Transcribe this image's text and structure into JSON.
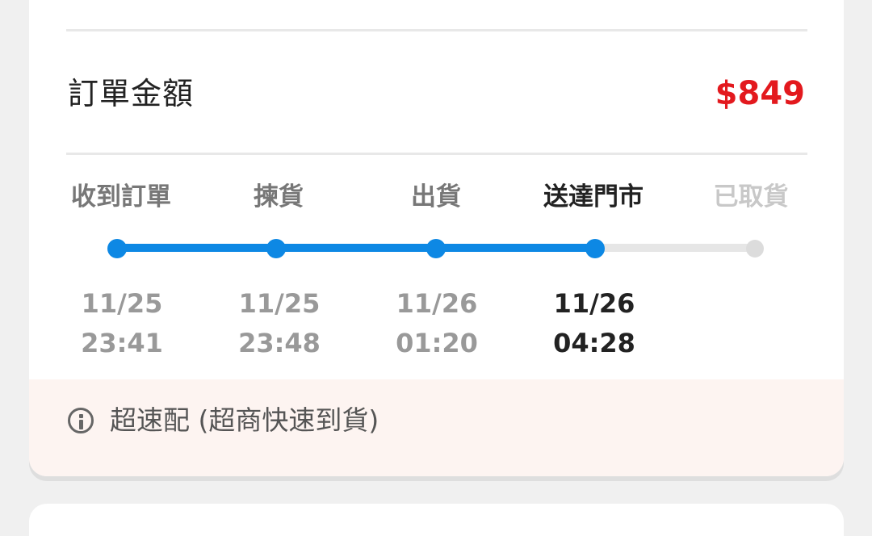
{
  "order": {
    "total_label": "訂單金額",
    "total_amount": "$849"
  },
  "tracking": {
    "progress_color": "#0d88e4",
    "pending_color": "#dcdcdc",
    "steps": [
      {
        "label": "收到訂單",
        "date": "11/25",
        "time": "23:41",
        "status": "done"
      },
      {
        "label": "揀貨",
        "date": "11/25",
        "time": "23:48",
        "status": "done"
      },
      {
        "label": "出貨",
        "date": "11/26",
        "time": "01:20",
        "status": "done"
      },
      {
        "label": "送達門市",
        "date": "11/26",
        "time": "04:28",
        "status": "current"
      },
      {
        "label": "已取貨",
        "status": "pending"
      }
    ]
  },
  "notice": {
    "icon": "info-icon",
    "text": "超速配 (超商快速到貨)"
  }
}
